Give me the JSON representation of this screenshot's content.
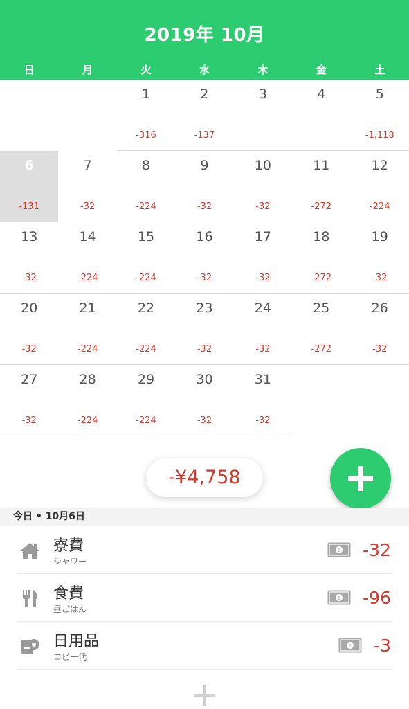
{
  "header": {
    "title": "2019年 10月",
    "color": "#2ecc71"
  },
  "weekdays": [
    "日",
    "月",
    "火",
    "水",
    "木",
    "金",
    "土"
  ],
  "calendar": {
    "selected_day": "6",
    "weeks": [
      [
        {
          "day": "",
          "amount": ""
        },
        {
          "day": "",
          "amount": ""
        },
        {
          "day": "1",
          "amount": "-316"
        },
        {
          "day": "2",
          "amount": "-137"
        },
        {
          "day": "3",
          "amount": ""
        },
        {
          "day": "4",
          "amount": ""
        },
        {
          "day": "5",
          "amount": "-1,118"
        }
      ],
      [
        {
          "day": "6",
          "amount": "-131"
        },
        {
          "day": "7",
          "amount": "-32"
        },
        {
          "day": "8",
          "amount": "-224"
        },
        {
          "day": "9",
          "amount": "-32"
        },
        {
          "day": "10",
          "amount": "-32"
        },
        {
          "day": "11",
          "amount": "-272"
        },
        {
          "day": "12",
          "amount": "-224"
        }
      ],
      [
        {
          "day": "13",
          "amount": "-32"
        },
        {
          "day": "14",
          "amount": "-224"
        },
        {
          "day": "15",
          "amount": "-224"
        },
        {
          "day": "16",
          "amount": "-32"
        },
        {
          "day": "17",
          "amount": "-32"
        },
        {
          "day": "18",
          "amount": "-272"
        },
        {
          "day": "19",
          "amount": "-32"
        }
      ],
      [
        {
          "day": "20",
          "amount": "-32"
        },
        {
          "day": "21",
          "amount": "-224"
        },
        {
          "day": "22",
          "amount": "-224"
        },
        {
          "day": "23",
          "amount": "-32"
        },
        {
          "day": "24",
          "amount": "-32"
        },
        {
          "day": "25",
          "amount": "-272"
        },
        {
          "day": "26",
          "amount": "-32"
        }
      ],
      [
        {
          "day": "27",
          "amount": "-32"
        },
        {
          "day": "28",
          "amount": "-224"
        },
        {
          "day": "29",
          "amount": "-224"
        },
        {
          "day": "30",
          "amount": "-32"
        },
        {
          "day": "31",
          "amount": "-32"
        },
        {
          "day": "",
          "amount": ""
        },
        {
          "day": "",
          "amount": ""
        }
      ]
    ]
  },
  "summary": {
    "total": "-¥4,758"
  },
  "fab": {
    "icon": "plus-icon"
  },
  "day_list": {
    "header": "今日 • 10月6日",
    "entries": [
      {
        "category": "寮費",
        "note": "シャワー",
        "amount": "-32",
        "icon": "house-icon",
        "payment_icon": "cash-icon"
      },
      {
        "category": "食費",
        "note": "昼ごはん",
        "amount": "-96",
        "icon": "fork-knife-icon",
        "payment_icon": "cash-icon"
      },
      {
        "category": "日用品",
        "note": "コピー代",
        "amount": "-3",
        "icon": "toilet-paper-icon",
        "payment_icon": "cash-icon"
      }
    ]
  },
  "colors": {
    "accent": "#2ecc71",
    "expense": "#d9382c",
    "selected_day_bg": "#dedede"
  }
}
